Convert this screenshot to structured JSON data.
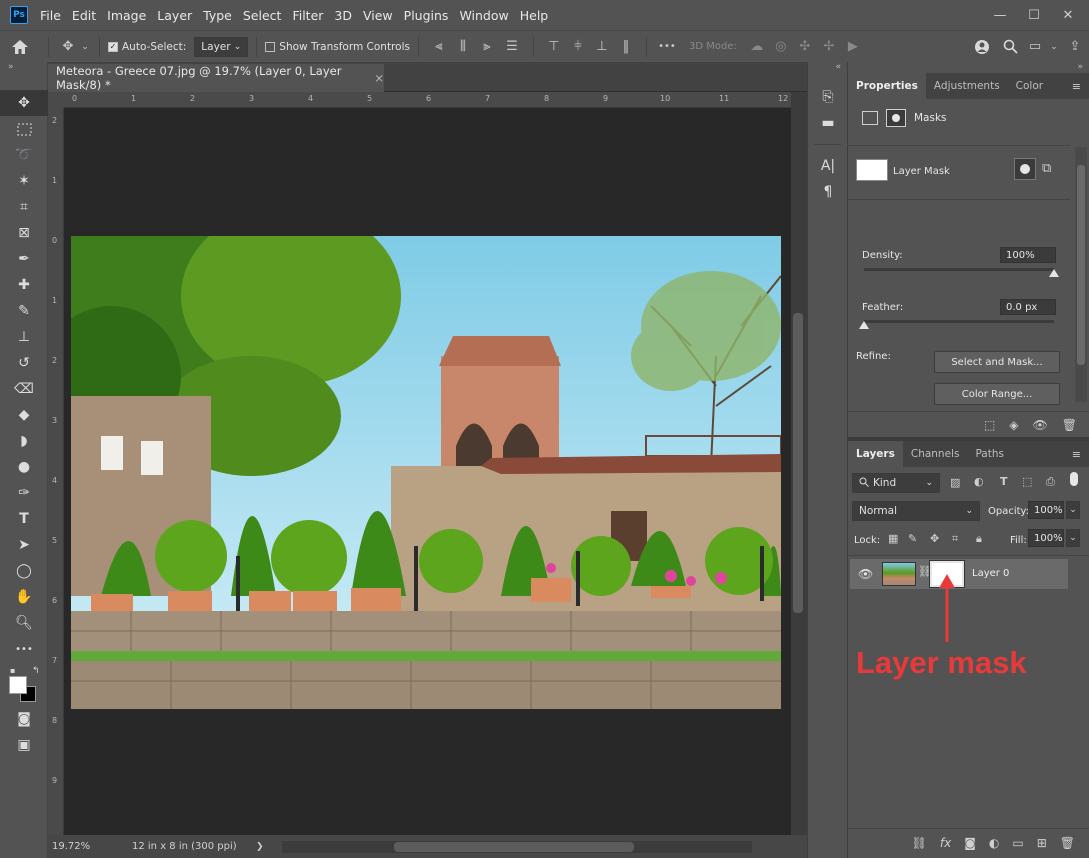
{
  "app": {
    "logo_text": "Ps"
  },
  "menu": [
    "File",
    "Edit",
    "Image",
    "Layer",
    "Type",
    "Select",
    "Filter",
    "3D",
    "View",
    "Plugins",
    "Window",
    "Help"
  ],
  "window_controls": {
    "minimize": "—",
    "maximize": "☐",
    "close": "✕"
  },
  "options": {
    "auto_select_label": "Auto-Select:",
    "auto_select_value": "Layer",
    "show_transform_label": "Show Transform Controls",
    "mode_3d_label": "3D Mode:",
    "more_label": "•••"
  },
  "document": {
    "tab_title": "Meteora - Greece 07.jpg @ 19.7% (Layer 0, Layer Mask/8) *",
    "tab_close": "×",
    "ruler_top": [
      "0",
      "1",
      "2",
      "3",
      "4",
      "5",
      "6",
      "7",
      "8",
      "9",
      "10",
      "11",
      "12"
    ],
    "ruler_left": [
      "2",
      "1",
      "0",
      "1",
      "2",
      "3",
      "4",
      "5",
      "6",
      "7",
      "8",
      "9"
    ],
    "zoom": "19.72%",
    "doc_info": "12 in x 8 in (300 ppi)",
    "status_arrow": "❯"
  },
  "properties": {
    "tabs": [
      "Properties",
      "Adjustments",
      "Color"
    ],
    "masks_label": "Masks",
    "layer_mask_label": "Layer Mask",
    "density_label": "Density:",
    "density_value": "100%",
    "density_fraction": 1.0,
    "feather_label": "Feather:",
    "feather_value": "0.0 px",
    "feather_fraction": 0.0,
    "refine_label": "Refine:",
    "select_and_mask_label": "Select and Mask...",
    "color_range_label": "Color Range..."
  },
  "layers": {
    "tabs": [
      "Layers",
      "Channels",
      "Paths"
    ],
    "kind_label": "Kind",
    "blend_mode": "Normal",
    "opacity_label": "Opacity:",
    "opacity_value": "100%",
    "lock_label": "Lock:",
    "fill_label": "Fill:",
    "fill_value": "100%",
    "layer_name": "Layer 0"
  },
  "annotation": {
    "text": "Layer mask",
    "color": "#e83a3a"
  },
  "colors": {
    "ui_bg": "#535353",
    "panel_dark": "#424242",
    "canvas_bg": "#282828",
    "accent_ps": "#2fa3f7"
  }
}
